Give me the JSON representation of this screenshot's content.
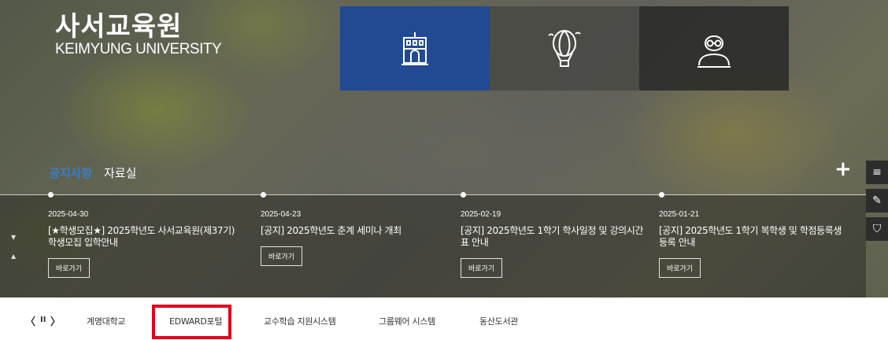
{
  "header": {
    "title": "사서교육원",
    "subtitle": "KEIMYUNG UNIVERSITY"
  },
  "quick_links": [
    {
      "icon": "building-icon",
      "color": "#214a93"
    },
    {
      "icon": "balloon-icon"
    },
    {
      "icon": "person-glasses-icon"
    }
  ],
  "board": {
    "tabs": [
      "공지사항",
      "자료실"
    ],
    "more_label": "+",
    "items": [
      {
        "date": "2025-04-30",
        "title": "[★학생모집★] 2025학년도 사서교육원(제37기) 학생모집 입학안내",
        "button": "바로가기"
      },
      {
        "date": "2025-04-23",
        "title": "[공지] 2025학년도 춘계 세미나 개최",
        "button": "바로가기"
      },
      {
        "date": "2025-02-19",
        "title": "[공지] 2025학년도 1학기 학사일정 및 강의시간표 안내",
        "button": "바로가기"
      },
      {
        "date": "2025-01-21",
        "title": "[공지] 2025학년도 1학기 복학생 및 학점등록생 등록 안내",
        "button": "바로가기"
      }
    ]
  },
  "side_buttons": [
    "menu-icon",
    "pencil-icon",
    "shield-icon"
  ],
  "family_sites": {
    "prev": "〈",
    "pause": "II",
    "next": "〉",
    "links": [
      "계명대학교",
      "EDWARD포털",
      "교수학습 지원시스템",
      "그룹웨어 시스템",
      "동산도서관"
    ]
  }
}
